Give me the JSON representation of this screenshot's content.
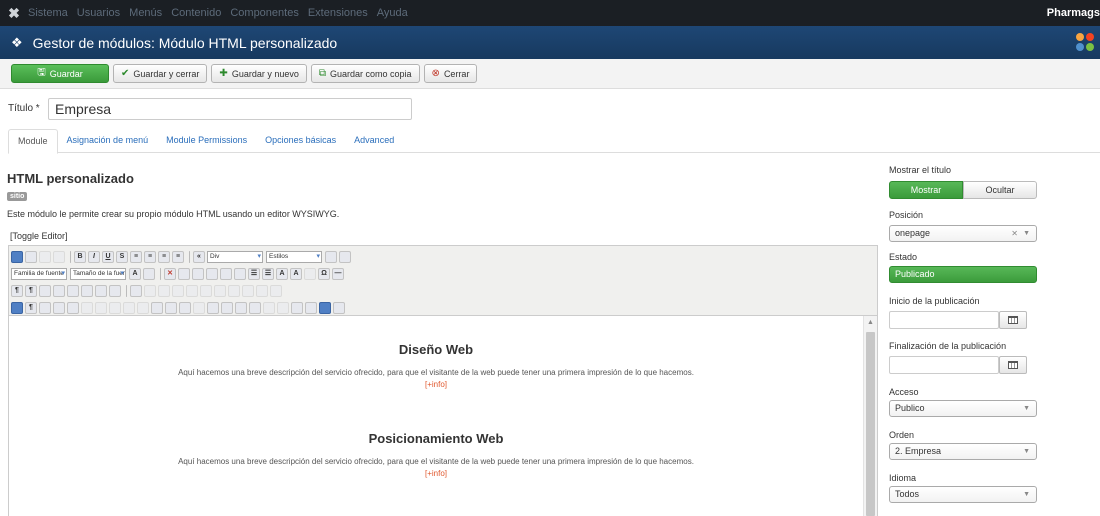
{
  "menubar": {
    "items": [
      "Sistema",
      "Usuarios",
      "Menús",
      "Contenido",
      "Componentes",
      "Extensiones",
      "Ayuda"
    ],
    "brand": "Pharmags"
  },
  "header": {
    "title": "Gestor de módulos: Módulo HTML personalizado"
  },
  "toolbar": {
    "save": "Guardar",
    "save_close": "Guardar y cerrar",
    "save_new": "Guardar y nuevo",
    "save_copy": "Guardar como copia",
    "close": "Cerrar"
  },
  "title_field": {
    "label": "Título *",
    "value": "Empresa"
  },
  "tabs": [
    "Module",
    "Asignación de menú",
    "Module Permissions",
    "Opciones básicas",
    "Advanced"
  ],
  "module": {
    "name": "HTML personalizado",
    "badge": "sitio",
    "description": "Este módulo le permite crear su propio módulo HTML usando un editor WYSIWYG.",
    "toggle_editor": "[Toggle Editor]"
  },
  "editor_toolbar": {
    "format_select": "Div",
    "styles_select": "Estilos",
    "font_family": "Familia de fuente",
    "font_size": "Tamaño de la fuente"
  },
  "content": {
    "sections": [
      {
        "heading": "Diseño Web",
        "text": "Aquí hacemos una breve descripción del servicio ofrecido, para que el visitante de la web puede tener una primera impresión de lo que hacemos.",
        "link": "[+info]"
      },
      {
        "heading": "Posicionamiento Web",
        "text": "Aquí hacemos una breve descripción del servicio ofrecido, para que el visitante de la web puede tener una primera impresión de lo que hacemos.",
        "link": "[+info]"
      }
    ]
  },
  "sidebar": {
    "show_title_label": "Mostrar el título",
    "show_on": "Mostrar",
    "show_off": "Ocultar",
    "position_label": "Posición",
    "position_value": "onepage",
    "state_label": "Estado",
    "state_value": "Publicado",
    "publish_start_label": "Inicio de la publicación",
    "publish_end_label": "Finalización de la publicación",
    "access_label": "Acceso",
    "access_value": "Publico",
    "order_label": "Orden",
    "order_value": "2. Empresa",
    "language_label": "Idioma",
    "language_value": "Todos"
  }
}
